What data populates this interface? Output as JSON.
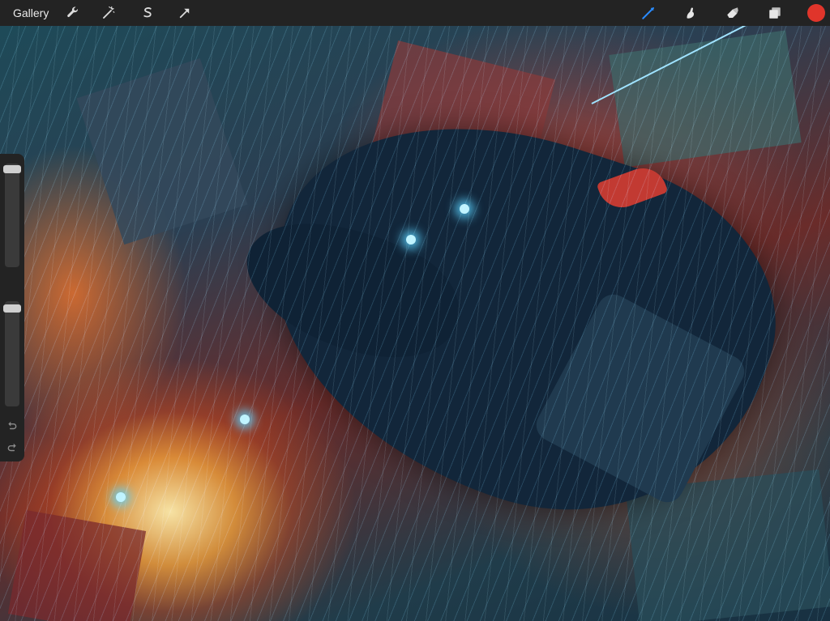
{
  "topbar": {
    "gallery_label": "Gallery",
    "left_tools": [
      {
        "name": "wrench-icon"
      },
      {
        "name": "magic-wand-icon"
      },
      {
        "name": "selection-icon"
      },
      {
        "name": "transform-arrow-icon"
      }
    ],
    "right_tools": [
      {
        "name": "brush-icon",
        "active": true
      },
      {
        "name": "smudge-icon"
      },
      {
        "name": "eraser-icon"
      },
      {
        "name": "layers-icon"
      }
    ],
    "current_color": "#e0352b",
    "active_tool_color": "#2a8cff"
  },
  "sidebar": {
    "brush_size": 0.05,
    "brush_opacity": 0.05,
    "undo_icon": "undo-icon",
    "redo_icon": "redo-icon"
  }
}
